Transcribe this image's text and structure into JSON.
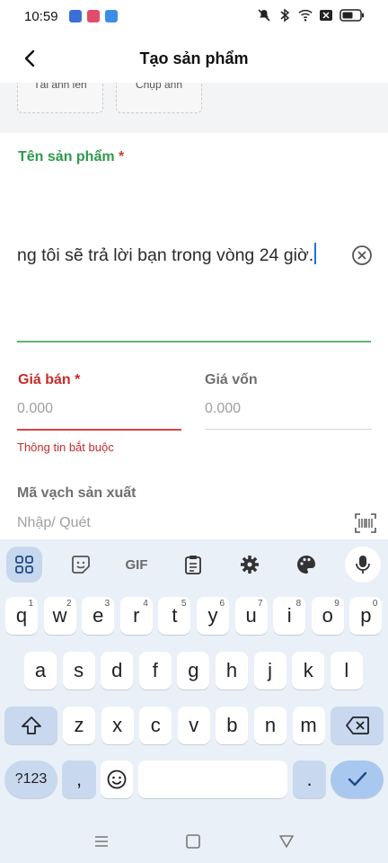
{
  "status_bar": {
    "time": "10:59",
    "app_colors": [
      "#3b6fd6",
      "#e24c6c",
      "#3a8ee6"
    ],
    "icons": [
      "mute-icon",
      "bluetooth-icon",
      "wifi-icon",
      "x-box-icon",
      "battery-icon"
    ]
  },
  "header": {
    "title": "Tạo sản phẩm"
  },
  "images": {
    "upload_label": "Tải ảnh lên",
    "capture_label": "Chụp ảnh"
  },
  "form": {
    "name_label": "Tên sản phẩm",
    "required_mark": "*",
    "name_value": "ng tôi sẽ trả lời bạn trong vòng 24 giờ.",
    "price_label": "Giá bán",
    "price_placeholder": "0.000",
    "cost_label": "Giá vốn",
    "cost_placeholder": "0.000",
    "error_text": "Thông tin bắt buộc",
    "barcode_label": "Mã vạch sản xuất",
    "barcode_placeholder": "Nhập/ Quét"
  },
  "keyboard": {
    "toolbar": {
      "gif_label": "GIF"
    },
    "row1": [
      {
        "k": "q",
        "s": "1"
      },
      {
        "k": "w",
        "s": "2"
      },
      {
        "k": "e",
        "s": "3"
      },
      {
        "k": "r",
        "s": "4"
      },
      {
        "k": "t",
        "s": "5"
      },
      {
        "k": "y",
        "s": "6"
      },
      {
        "k": "u",
        "s": "7"
      },
      {
        "k": "i",
        "s": "8"
      },
      {
        "k": "o",
        "s": "9"
      },
      {
        "k": "p",
        "s": "0"
      }
    ],
    "row2": [
      "a",
      "s",
      "d",
      "f",
      "g",
      "h",
      "j",
      "k",
      "l"
    ],
    "row3": [
      "z",
      "x",
      "c",
      "v",
      "b",
      "n",
      "m"
    ],
    "symbols_label": "?123",
    "comma": ",",
    "period": ".",
    "colors": {
      "accent": "#1a73e8",
      "green": "#2e9a4c",
      "red": "#c62b2b"
    }
  }
}
